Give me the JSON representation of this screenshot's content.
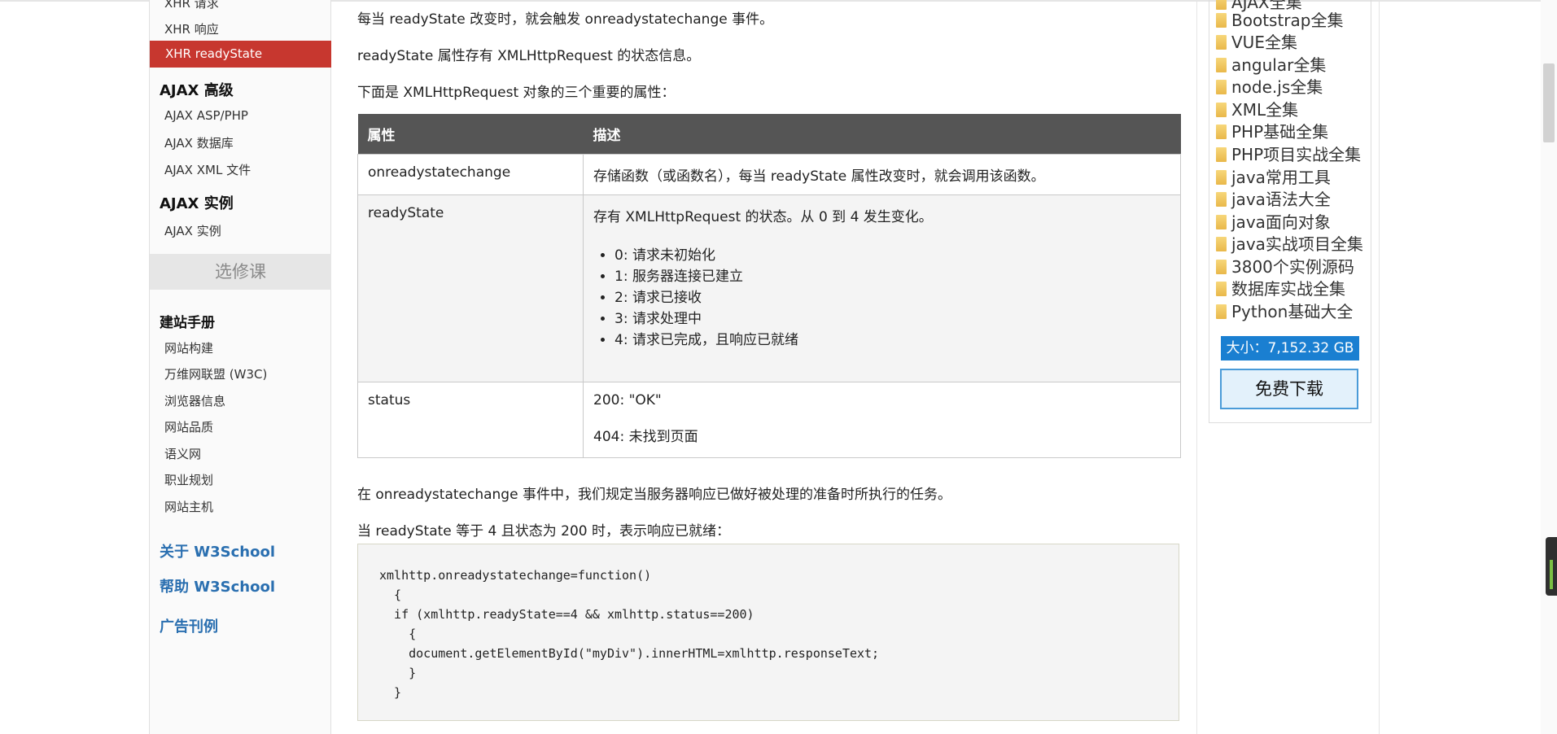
{
  "sidebar": {
    "items_top": [
      "XHR 请求",
      "XHR 响应"
    ],
    "active_item": "XHR readyState",
    "advanced_heading": "AJAX 高级",
    "advanced_items": [
      "AJAX ASP/PHP",
      "AJAX 数据库",
      "AJAX XML 文件"
    ],
    "examples_heading": "AJAX 实例",
    "examples_items": [
      "AJAX 实例"
    ],
    "elective": "选修课",
    "manual_heading": "建站手册",
    "manual_items": [
      "网站构建",
      "万维网联盟 (W3C)",
      "浏览器信息",
      "网站品质",
      "语义网",
      "职业规划",
      "网站主机"
    ],
    "about_link": "关于 W3School",
    "help_link": "帮助 W3School",
    "ads_link": "广告刊例"
  },
  "main": {
    "para1": "每当 readyState 改变时，就会触发 onreadystatechange 事件。",
    "para2": "readyState 属性存有 XMLHttpRequest 的状态信息。",
    "para3": "下面是 XMLHttpRequest 对象的三个重要的属性：",
    "table": {
      "headers": [
        "属性",
        "描述"
      ],
      "rows": [
        {
          "prop": "onreadystatechange",
          "desc": "存储函数（或函数名），每当 readyState 属性改变时，就会调用该函数。"
        },
        {
          "prop": "readyState",
          "desc": "存有 XMLHttpRequest 的状态。从 0 到 4 发生变化。",
          "list": [
            "0: 请求未初始化",
            "1: 服务器连接已建立",
            "2: 请求已接收",
            "3: 请求处理中",
            "4: 请求已完成，且响应已就绪"
          ]
        },
        {
          "prop": "status",
          "desc_lines": [
            "200: \"OK\"",
            "404: 未找到页面"
          ]
        }
      ]
    },
    "para4": "在 onreadystatechange 事件中，我们规定当服务器响应已做好被处理的准备时所执行的任务。",
    "para5": "当 readyState 等于 4 且状态为 200 时，表示响应已就绪：",
    "code": "xmlhttp.onreadystatechange=function()\n  {\n  if (xmlhttp.readyState==4 && xmlhttp.status==200)\n    {\n    document.getElementById(\"myDiv\").innerHTML=xmlhttp.responseText;\n    }\n  }"
  },
  "right": {
    "folders": [
      "AJAX全集",
      "Bootstrap全集",
      "VUE全集",
      "angular全集",
      "node.js全集",
      "XML全集",
      "PHP基础全集",
      "PHP项目实战全集",
      "java常用工具",
      "java语法大全",
      "java面向对象",
      "java实战项目全集",
      "3800个实例源码",
      "数据库实战全集",
      "Python基础大全"
    ],
    "size_label": "大小：7,152.32 GB",
    "download_label": "免费下载"
  },
  "icons": {
    "folder": "folder-icon"
  },
  "colors": {
    "active_nav": "#c7372f",
    "table_header": "#555555",
    "link_blue": "#2a6fb0",
    "badge_blue": "#1a7fd1"
  }
}
